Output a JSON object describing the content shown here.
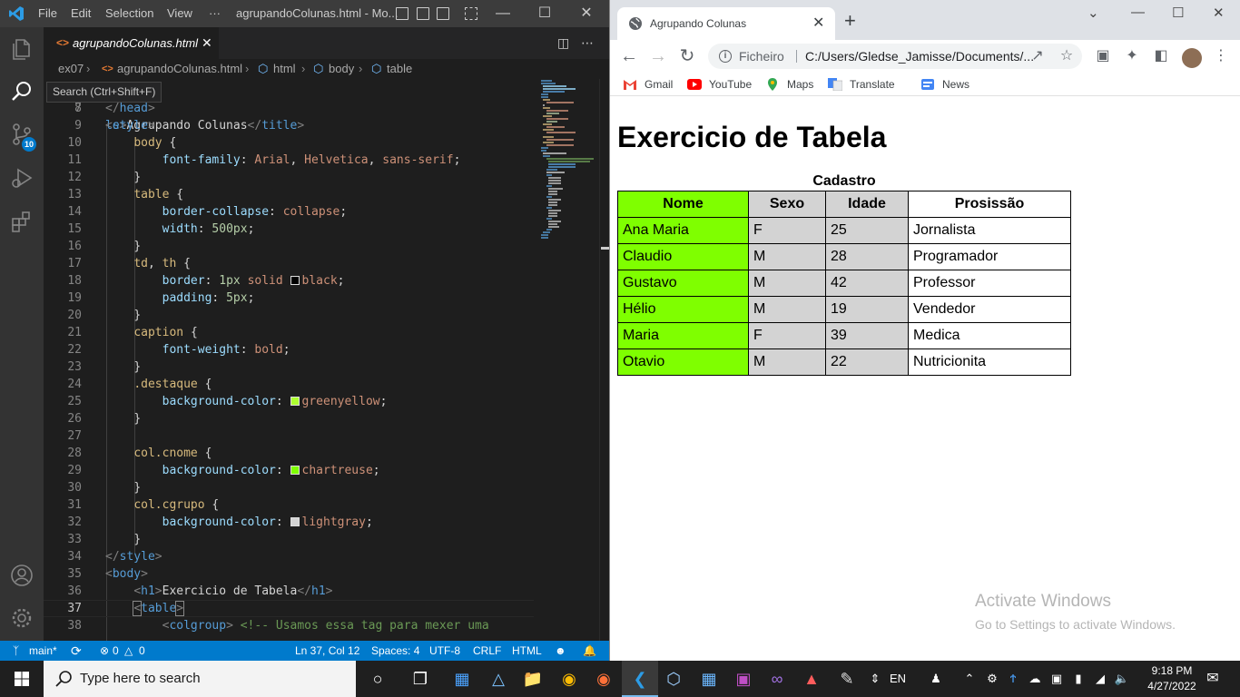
{
  "vscode": {
    "menu": [
      "File",
      "Edit",
      "Selection",
      "View",
      "···"
    ],
    "window_title": "agrupandoColunas.html - Mo...",
    "tab": {
      "label": "agrupandoColunas.html",
      "icon": "html-file-icon"
    },
    "breadcrumb": [
      "ex07",
      "agrupandoColunas.html",
      "html",
      "body",
      "table"
    ],
    "tooltip": "Search (Ctrl+Shift+F)",
    "scm_badge": "10",
    "status": {
      "branch": "main*",
      "errors": "0",
      "warnings": "0",
      "position": "Ln 37, Col 12",
      "spaces": "Spaces: 4",
      "encoding": "UTF-8",
      "eol": "CRLF",
      "language": "HTML"
    },
    "code_lines": [
      {
        "n": "7",
        "text": "le>Agrupando Colunas</title>"
      },
      {
        "n": "8",
        "text": "</head>"
      },
      {
        "n": "9",
        "text": "<style>"
      },
      {
        "n": "10",
        "text": "body {"
      },
      {
        "n": "11",
        "text": "font-family: Arial, Helvetica, sans-serif;"
      },
      {
        "n": "12",
        "text": "}"
      },
      {
        "n": "13",
        "text": "table {"
      },
      {
        "n": "14",
        "text": "border-collapse: collapse;"
      },
      {
        "n": "15",
        "text": "width: 500px;"
      },
      {
        "n": "16",
        "text": "}"
      },
      {
        "n": "17",
        "text": "td, th {"
      },
      {
        "n": "18",
        "text": "border: 1px solid black;"
      },
      {
        "n": "19",
        "text": "padding: 5px;"
      },
      {
        "n": "20",
        "text": "}"
      },
      {
        "n": "21",
        "text": "caption {"
      },
      {
        "n": "22",
        "text": "font-weight: bold;"
      },
      {
        "n": "23",
        "text": "}"
      },
      {
        "n": "24",
        "text": ".destaque {"
      },
      {
        "n": "25",
        "text": "background-color: greenyellow;"
      },
      {
        "n": "26",
        "text": "}"
      },
      {
        "n": "27",
        "text": ""
      },
      {
        "n": "28",
        "text": "col.cnome {"
      },
      {
        "n": "29",
        "text": "background-color: chartreuse;"
      },
      {
        "n": "30",
        "text": "}"
      },
      {
        "n": "31",
        "text": "col.cgrupo {"
      },
      {
        "n": "32",
        "text": "background-color: lightgray;"
      },
      {
        "n": "33",
        "text": "}"
      },
      {
        "n": "34",
        "text": "</style>"
      },
      {
        "n": "35",
        "text": "<body>"
      },
      {
        "n": "36",
        "text": "<h1>Exercicio de Tabela</h1>"
      },
      {
        "n": "37",
        "text": "<table>"
      },
      {
        "n": "38",
        "text": "<colgroup> <!-- Usamos essa tag para mexer uma"
      }
    ]
  },
  "chrome": {
    "tab_title": "Agrupando Colunas",
    "scheme_label": "Ficheiro",
    "url": "C:/Users/Gledse_Jamisse/Documents/...",
    "bookmarks": [
      "Gmail",
      "YouTube",
      "Maps",
      "Translate",
      "News"
    ]
  },
  "page": {
    "heading": "Exercicio de Tabela",
    "caption": "Cadastro",
    "headers": [
      "Nome",
      "Sexo",
      "Idade",
      "Prosissão"
    ],
    "rows": [
      [
        "Ana Maria",
        "F",
        "25",
        "Jornalista"
      ],
      [
        "Claudio",
        "M",
        "28",
        "Programador"
      ],
      [
        "Gustavo",
        "M",
        "42",
        "Professor"
      ],
      [
        "Hélio",
        "M",
        "19",
        "Vendedor"
      ],
      [
        "Maria",
        "F",
        "39",
        "Medica"
      ],
      [
        "Otavio",
        "M",
        "22",
        "Nutricionita"
      ]
    ],
    "colors": {
      "cnome": "#7fff00",
      "cgrupo": "#d3d3d3"
    }
  },
  "watermark": {
    "line1": "Activate Windows",
    "line2": "Go to Settings to activate Windows."
  },
  "taskbar": {
    "search_placeholder": "Type here to search",
    "lang": "EN",
    "time": "9:18 PM",
    "date": "4/27/2022"
  }
}
